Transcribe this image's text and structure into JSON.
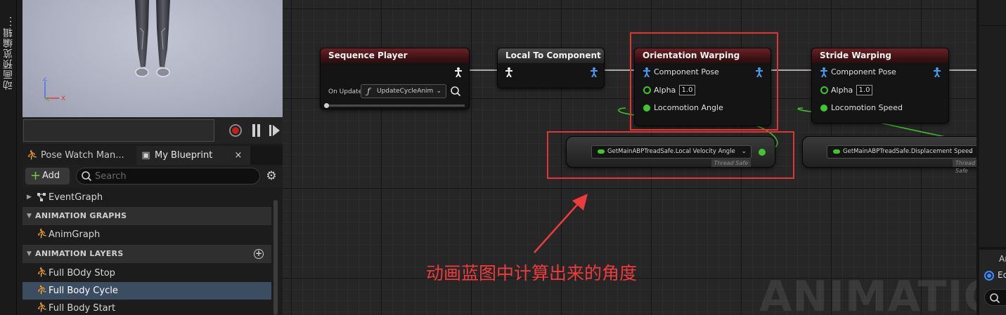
{
  "side_tab": {
    "label": "动画预览编辑..."
  },
  "preview": {
    "axis_labels": {
      "z": "Z",
      "x": "X"
    },
    "transport": {
      "record": "record-icon",
      "pause": "pause-icon",
      "step": "step-forward-icon"
    }
  },
  "tabs": [
    {
      "label": "Pose Watch Man...",
      "icon": "pose-watch-icon"
    },
    {
      "label": "My Blueprint",
      "icon": "blueprint-book-icon",
      "close": "×"
    }
  ],
  "toolbar": {
    "add_label": "Add",
    "add_icon": "+",
    "search_placeholder": "Search"
  },
  "tree": {
    "event_graph": "EventGraph",
    "section_graphs": "ANIMATION GRAPHS",
    "anim_graph": "AnimGraph",
    "section_layers": "ANIMATION LAYERS",
    "section_layers_add": "+",
    "layers": [
      "Full BOdy Stop",
      "Full Body Cycle",
      "Full Body Start"
    ],
    "selected_index": 1
  },
  "graph": {
    "watermark": "ANIMATION",
    "sequence_player": {
      "title": "Sequence Player",
      "on_update_label": "On Update",
      "function_icon": "ƒ",
      "function_value": "UpdateCycleAnim"
    },
    "local_to_component": {
      "title": "Local To Component"
    },
    "orientation_warping": {
      "title": "Orientation Warping",
      "pins": [
        {
          "label": "Component Pose"
        },
        {
          "label": "Alpha",
          "value": "1.0"
        },
        {
          "label": "Locomotion Angle"
        }
      ]
    },
    "stride_warping": {
      "title": "Stride Warping",
      "pins": [
        {
          "label": "Component Pose"
        },
        {
          "label": "Alpha",
          "value": "1.0"
        },
        {
          "label": "Locomotion Speed"
        }
      ]
    },
    "getter_angle": {
      "value": "GetMainABPTreadSafe.Local Velocity Angle",
      "badge": "Thread Safe"
    },
    "getter_speed": {
      "value": "GetMainABPTreadSafe.Displacement Speed",
      "badge": "Thread Safe"
    },
    "annotation": "动画蓝图中计算出来的角度",
    "colors": {
      "annotation": "#ee3b3b",
      "pin_float": "#3ec82a",
      "pin_pose": "#4a9bf0",
      "head_red": "#6a2024"
    }
  },
  "right_panel": {
    "label": "Ar",
    "radio_label": "Ec",
    "radio_selected": true
  }
}
